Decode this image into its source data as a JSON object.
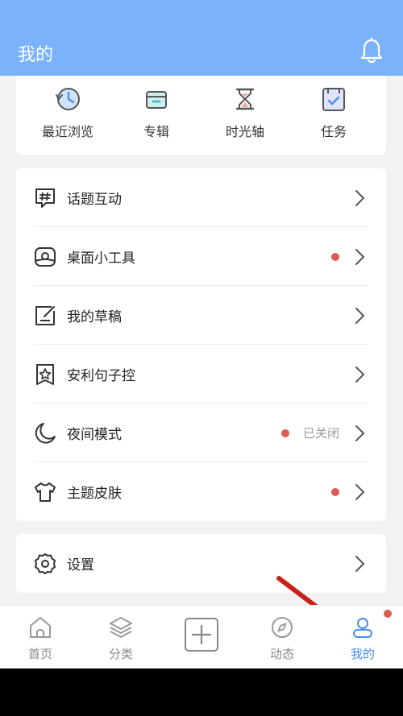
{
  "header": {
    "title": "我的"
  },
  "quick_actions": [
    {
      "label": "最近浏览",
      "icon": "clock-history-icon"
    },
    {
      "label": "专辑",
      "icon": "album-box-icon"
    },
    {
      "label": "时光轴",
      "icon": "hourglass-icon"
    },
    {
      "label": "任务",
      "icon": "task-checklist-icon"
    }
  ],
  "menu": [
    {
      "label": "话题互动",
      "icon": "hashtag-chat-icon",
      "dot": false
    },
    {
      "label": "桌面小工具",
      "icon": "widget-icon",
      "dot": true
    },
    {
      "label": "我的草稿",
      "icon": "draft-edit-icon",
      "dot": false
    },
    {
      "label": "安利句子控",
      "icon": "star-bookmark-icon",
      "dot": false
    },
    {
      "label": "夜间模式",
      "icon": "moon-icon",
      "dot": true,
      "status": "已关闭"
    },
    {
      "label": "主题皮肤",
      "icon": "tshirt-icon",
      "dot": true
    }
  ],
  "settings": {
    "label": "设置",
    "icon": "gear-icon"
  },
  "tabs": [
    {
      "label": "首页",
      "icon": "home-icon"
    },
    {
      "label": "分类",
      "icon": "layers-icon"
    },
    {
      "label": "",
      "icon": "add-square-icon"
    },
    {
      "label": "动态",
      "icon": "compass-icon"
    },
    {
      "label": "我的",
      "icon": "user-icon",
      "active": true
    }
  ],
  "colors": {
    "header_bg": "#7ab3fb",
    "accent": "#4a8df0",
    "badge_red": "#e05a4f",
    "annotation_arrow": "#c8241c"
  }
}
